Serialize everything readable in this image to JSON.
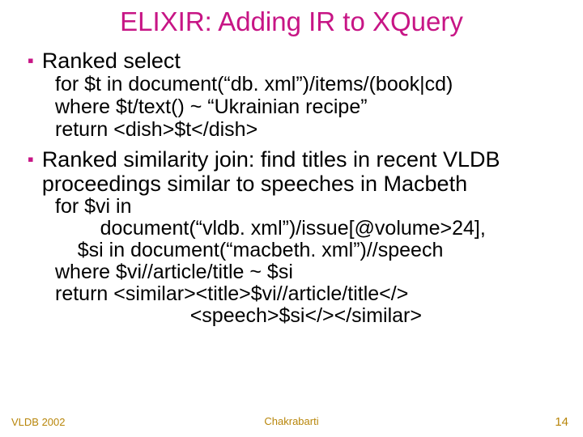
{
  "title": "ELIXIR: Adding IR to XQuery",
  "bullets": [
    {
      "label": "Ranked select",
      "code": "for $t in document(“db. xml”)/items/(book|cd)\nwhere $t/text() ~ “Ukrainian recipe”\nreturn <dish>$t</dish>"
    },
    {
      "label": "Ranked similarity join: find titles in recent VLDB proceedings similar to speeches in Macbeth",
      "code": "for $vi in\n        document(“vldb. xml”)/issue[@volume>24],\n    $si in document(“macbeth. xml”)//speech\nwhere $vi//article/title ~ $si\nreturn <similar><title>$vi//article/title</>\n                        <speech>$si</></similar>"
    }
  ],
  "footer": {
    "left": "VLDB 2002",
    "center": "Chakrabarti",
    "right": "14"
  }
}
